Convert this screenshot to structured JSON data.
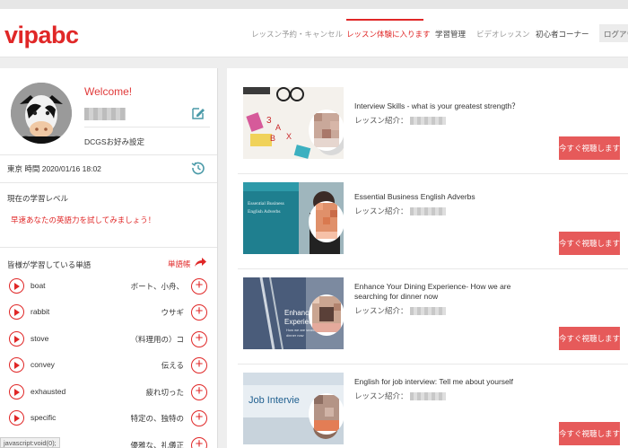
{
  "header": {
    "logo": "vipabc",
    "nav": [
      {
        "label": "レッスン予約・キャンセル"
      },
      {
        "label": "レッスン体験に入ります"
      },
      {
        "label": "学習管理"
      },
      {
        "label": "ビデオレッスン"
      },
      {
        "label": "初心者コーナー"
      }
    ],
    "login": "ログアウト"
  },
  "profile": {
    "welcome": "Welcome!",
    "dcgs_settings": "DCGSお好み設定",
    "timezone_label": "東京 時間 2020/01/16 18:02"
  },
  "level": {
    "title": "現在の学習レベル",
    "link": "早速あなたの英語力を試してみましょう！"
  },
  "words": {
    "title": "皆様が学習している単語",
    "wordbook_label": "単語帳",
    "items": [
      {
        "en": "boat",
        "jp": "ボート、小舟、"
      },
      {
        "en": "rabbit",
        "jp": "ウサギ"
      },
      {
        "en": "stove",
        "jp": "（料理用の）コ"
      },
      {
        "en": "convey",
        "jp": "伝える"
      },
      {
        "en": "exhausted",
        "jp": "疲れ切った"
      },
      {
        "en": "specific",
        "jp": "特定の、独特の"
      },
      {
        "en": "",
        "jp": "優雅な、礼儀正"
      }
    ]
  },
  "status": {
    "text": "javascript:void(0);"
  },
  "videos": [
    {
      "title": "Interview Skills - what is your greatest strength？",
      "sub": "レッスン紹介：",
      "button": "今すぐ視聴します"
    },
    {
      "title": "Essential Business English Adverbs",
      "sub": "レッスン紹介：",
      "button": "今すぐ視聴します",
      "thumb_text": [
        "Essential Business",
        "English Adverbs"
      ]
    },
    {
      "title": "Enhance Your Dining Experience- How we are searching for dinner now",
      "sub": "レッスン紹介：",
      "button": "今すぐ視聴します",
      "thumb_text": [
        "Enhance Yo",
        "Experience",
        "How we are search",
        "dinner now"
      ]
    },
    {
      "title": "English for job interview: Tell me about yourself",
      "sub": "レッスン紹介：",
      "button": "今すぐ視聴します",
      "thumb_text": [
        "Job Intervie"
      ]
    }
  ],
  "colors": {
    "accent": "#e02727",
    "button": "#e65a5a"
  }
}
